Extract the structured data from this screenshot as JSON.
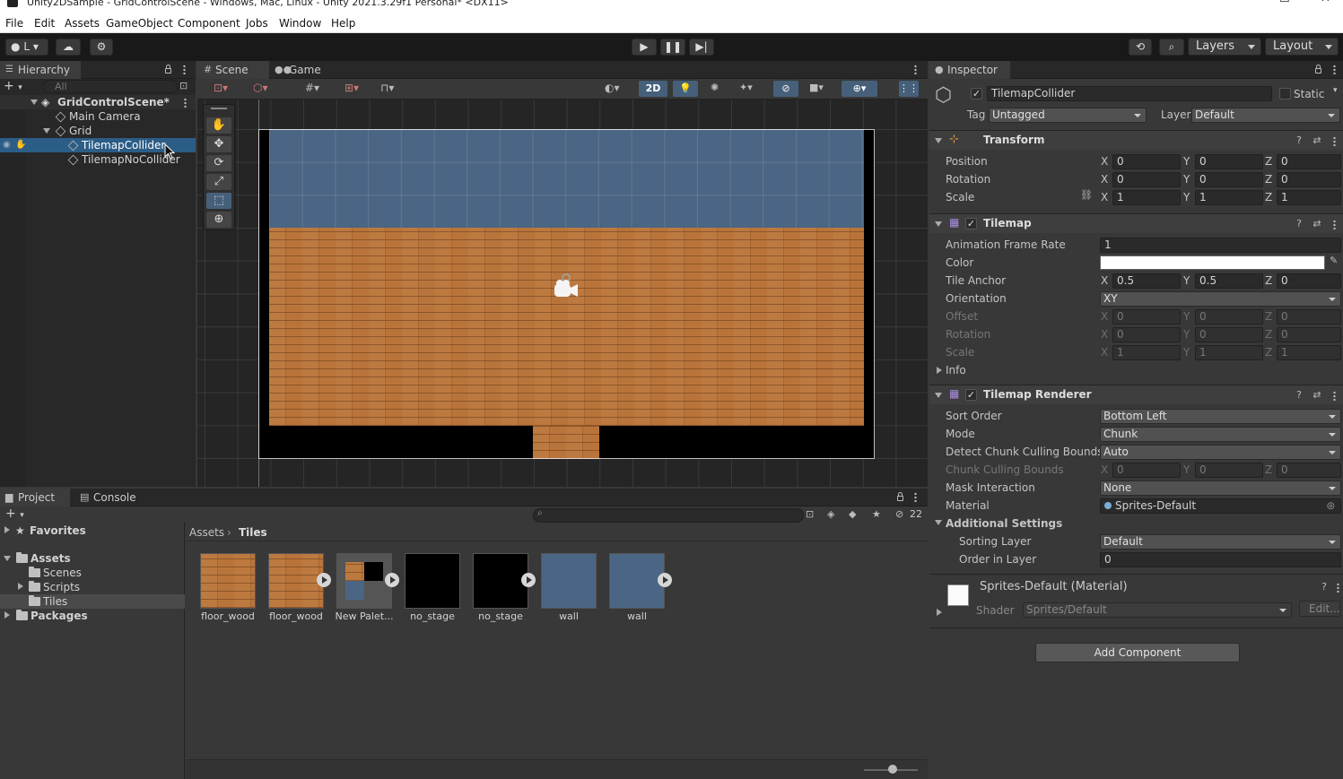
{
  "window": {
    "title": "Unity2DSample - GridControlScene - Windows, Mac, Linux - Unity 2021.3.29f1 Personal* <DX11>"
  },
  "menu": [
    "File",
    "Edit",
    "Assets",
    "GameObject",
    "Component",
    "Jobs",
    "Window",
    "Help"
  ],
  "toolbar": {
    "account": "L",
    "layers_label": "Layers",
    "layout_label": "Layout"
  },
  "hierarchy": {
    "tab": "Hierarchy",
    "search_placeholder": "All",
    "scene": "GridControlScene*",
    "items": [
      "Main Camera",
      "Grid",
      "TilemapCollider",
      "TilemapNoCollider"
    ]
  },
  "scene_view": {
    "tabs": [
      "Scene",
      "Game"
    ],
    "mode_2d": "2D"
  },
  "inspector": {
    "tab": "Inspector",
    "object_name": "TilemapCollider",
    "static_label": "Static",
    "tag_label": "Tag",
    "tag_value": "Untagged",
    "layer_label": "Layer",
    "layer_value": "Default",
    "transform": {
      "title": "Transform",
      "position_label": "Position",
      "rotation_label": "Rotation",
      "scale_label": "Scale",
      "position": [
        "0",
        "0",
        "0"
      ],
      "rotation": [
        "0",
        "0",
        "0"
      ],
      "scale": [
        "1",
        "1",
        "1"
      ]
    },
    "tilemap": {
      "title": "Tilemap",
      "anim_label": "Animation Frame Rate",
      "anim_value": "1",
      "color_label": "Color",
      "tile_anchor_label": "Tile Anchor",
      "tile_anchor": [
        "0.5",
        "0.5",
        "0"
      ],
      "orientation_label": "Orientation",
      "orientation_value": "XY",
      "offset_label": "Offset",
      "offset": [
        "0",
        "0",
        "0"
      ],
      "rotation_label": "Rotation",
      "rotation": [
        "0",
        "0",
        "0"
      ],
      "scale_label": "Scale",
      "scale": [
        "1",
        "1",
        "1"
      ],
      "info_label": "Info"
    },
    "renderer": {
      "title": "Tilemap Renderer",
      "sort_order_label": "Sort Order",
      "sort_order": "Bottom Left",
      "mode_label": "Mode",
      "mode": "Chunk",
      "detect_label": "Detect Chunk Culling Bounds",
      "detect": "Auto",
      "chunk_bounds_label": "Chunk Culling Bounds",
      "chunk_bounds": [
        "0",
        "0",
        "0"
      ],
      "mask_label": "Mask Interaction",
      "mask": "None",
      "material_label": "Material",
      "material": "Sprites-Default",
      "additional_label": "Additional Settings",
      "sorting_layer_label": "Sorting Layer",
      "sorting_layer": "Default",
      "order_label": "Order in Layer",
      "order": "0"
    },
    "material": {
      "title": "Sprites-Default (Material)",
      "shader_label": "Shader",
      "shader": "Sprites/Default",
      "edit_label": "Edit..."
    },
    "add_component": "Add Component"
  },
  "project": {
    "tabs": [
      "Project",
      "Console"
    ],
    "hidden_count": "22",
    "favorites": "Favorites",
    "assets": "Assets",
    "folders": [
      "Scenes",
      "Scripts",
      "Tiles"
    ],
    "packages": "Packages",
    "breadcrumb": [
      "Assets",
      "Tiles"
    ],
    "items": [
      {
        "label": "floor_wood",
        "kind": "wood"
      },
      {
        "label": "floor_wood",
        "kind": "wood"
      },
      {
        "label": "New Palet...",
        "kind": "palette"
      },
      {
        "label": "no_stage",
        "kind": "black"
      },
      {
        "label": "no_stage",
        "kind": "black"
      },
      {
        "label": "wall",
        "kind": "wall"
      },
      {
        "label": "wall",
        "kind": "wall"
      }
    ]
  },
  "colors": {
    "selection": "#2c5d87",
    "wall": "#4b6584",
    "wood": "#b8743a"
  }
}
